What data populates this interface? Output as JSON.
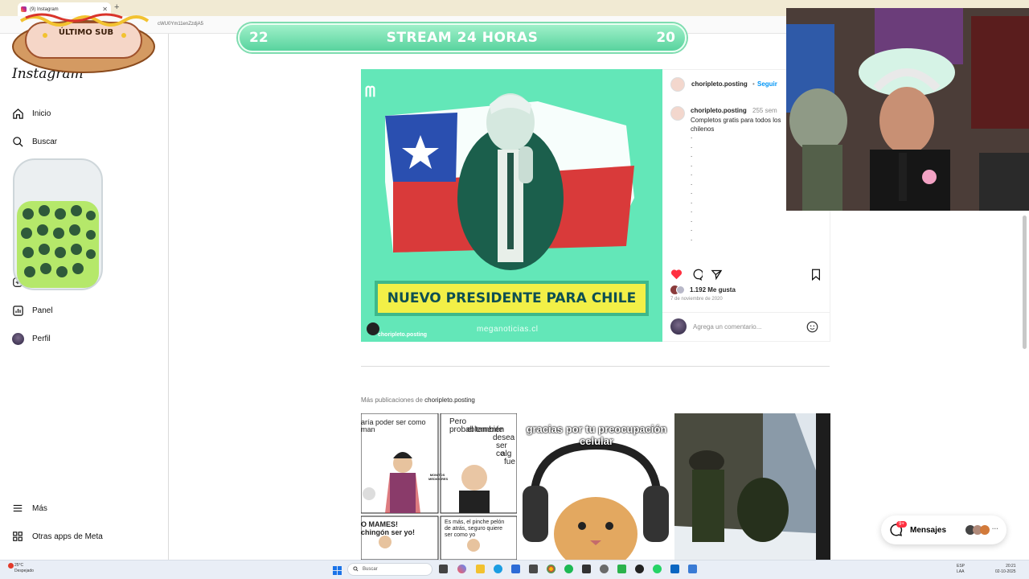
{
  "browser": {
    "tab_title": "(9) Instagram",
    "url_fragment": "cWU0Ym11enZzdjA5"
  },
  "stream_banner": {
    "left_number": "22",
    "title": "STREAM 24 HORAS",
    "right_number": "20"
  },
  "overlay": {
    "last_sub_label": "ÚLTIMO SUB"
  },
  "sidebar": {
    "logo": "Instagram",
    "items": [
      {
        "label": "Inicio",
        "icon": "home-icon"
      },
      {
        "label": "Buscar",
        "icon": "search-icon"
      },
      {
        "label": "Panel",
        "icon": "panel-icon"
      },
      {
        "label": "Perfil",
        "icon": "profile-icon"
      }
    ],
    "bottom_items": [
      {
        "label": "Más",
        "icon": "menu-icon"
      },
      {
        "label": "Otras apps de Meta",
        "icon": "meta-apps-icon"
      }
    ]
  },
  "post": {
    "image_caption": "NUEVO PRESIDENTE PARA CHILE",
    "image_watermark": "meganoticias.cl",
    "image_credit": "choripleto.posting",
    "author": "choripleto.posting",
    "follow_label": "Seguir",
    "separator": "•",
    "comment_author": "choripleto.posting",
    "comment_age": "255 sem",
    "comment_text": "Completos gratis para todos los chilenos",
    "comment_dots": [
      ".",
      ".",
      ".",
      ".",
      ".",
      ".",
      ".",
      ".",
      ".",
      ".",
      ".",
      "."
    ],
    "likes": "1.192 Me gusta",
    "date": "7 de noviembre de 2020",
    "comment_placeholder": "Agrega un comentario..."
  },
  "more_posts": {
    "prefix": "Más publicaciones de",
    "account": "choripleto.posting",
    "thumb1_texts": [
      "aría poder ser como",
      "man",
      "Pero probablemente",
      "el también",
      "desea",
      "ser co",
      "alg",
      "fue",
      "O MAMES!",
      "chingón ser yo!",
      "Es más, el pinche pelón",
      "de atrás, seguro quiere",
      "ser como yo"
    ],
    "thumb1_tag": "MONITOS MEDIOCRES",
    "thumb2_text": "gracias por tu preocupación celular"
  },
  "messages": {
    "label": "Mensajes",
    "badge": "9+"
  },
  "taskbar": {
    "weather_temp": "25°C",
    "weather_desc": "Despejado",
    "search_placeholder": "Buscar",
    "lang": "ESP",
    "region": "LAA",
    "time": "20:21",
    "date": "02-10-2025"
  },
  "colors": {
    "instagram_blue": "#0095f6",
    "like_red": "#ff3040",
    "banner_green": "#58d39e",
    "post_bg": "#63e7b8"
  }
}
